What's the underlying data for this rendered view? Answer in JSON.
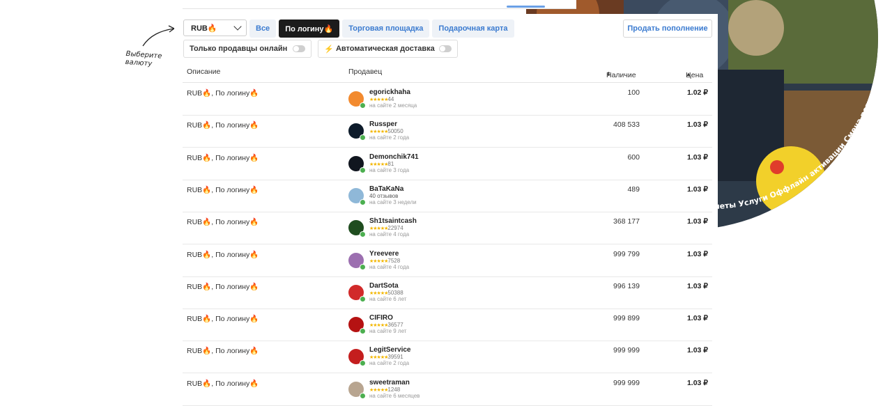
{
  "hint": {
    "text": "Выберите валюту"
  },
  "filters": {
    "currency": "RUB🔥",
    "tabs": [
      {
        "label": "Все",
        "active": false
      },
      {
        "label": "По логину🔥",
        "active": true
      },
      {
        "label": "Торговая площадка",
        "active": false
      },
      {
        "label": "Подарочная карта",
        "active": false
      }
    ],
    "sell_button": "Продать пополнение",
    "online_toggle": "Только продавцы онлайн",
    "auto_delivery_toggle": "Автоматическая доставка"
  },
  "banner": {
    "curved_text": "дметы Услуги Оффлайн активации Смена региона"
  },
  "table": {
    "headers": {
      "description": "Описание",
      "seller": "Продавец",
      "stock": "Наличие",
      "price": "Цена"
    },
    "rows": [
      {
        "desc": "RUB🔥, По логину🔥",
        "seller": "egorickhaha",
        "rating": "44",
        "since": "на сайте 2 месяца",
        "qty": "100",
        "price": "1.02 ₽",
        "avatar_color": "#f28a2e"
      },
      {
        "desc": "RUB🔥, По логину🔥",
        "seller": "Russper",
        "rating": "50050",
        "since": "на сайте 2 года",
        "qty": "408 533",
        "price": "1.03 ₽",
        "avatar_color": "#0d1b2a"
      },
      {
        "desc": "RUB🔥, По логину🔥",
        "seller": "Demonchik741",
        "rating": "81",
        "since": "на сайте 3 года",
        "qty": "600",
        "price": "1.03 ₽",
        "avatar_color": "#11161f"
      },
      {
        "desc": "RUB🔥, По логину🔥",
        "seller": "BaTaKaNa",
        "rating": "40 отзывов",
        "since": "на сайте 3 недели",
        "qty": "489",
        "price": "1.03 ₽",
        "avatar_color": "#8fb8d8"
      },
      {
        "desc": "RUB🔥, По логину🔥",
        "seller": "Sh1tsaintcash",
        "rating": "22974",
        "since": "на сайте 4 года",
        "qty": "368 177",
        "price": "1.03 ₽",
        "avatar_color": "#1f4d1f"
      },
      {
        "desc": "RUB🔥, По логину🔥",
        "seller": "Yreevere",
        "rating": "7528",
        "since": "на сайте 4 года",
        "qty": "999 799",
        "price": "1.03 ₽",
        "avatar_color": "#9c6fb0"
      },
      {
        "desc": "RUB🔥, По логину🔥",
        "seller": "DartSota",
        "rating": "50388",
        "since": "на сайте 6 лет",
        "qty": "996 139",
        "price": "1.03 ₽",
        "avatar_color": "#d12a2a"
      },
      {
        "desc": "RUB🔥, По логину🔥",
        "seller": "CIFIRO",
        "rating": "36577",
        "since": "на сайте 9 лет",
        "qty": "999 899",
        "price": "1.03 ₽",
        "avatar_color": "#b51212"
      },
      {
        "desc": "RUB🔥, По логину🔥",
        "seller": "LegitService",
        "rating": "39591",
        "since": "на сайте 2 года",
        "qty": "999 999",
        "price": "1.03 ₽",
        "avatar_color": "#c41e1e"
      },
      {
        "desc": "RUB🔥, По логину🔥",
        "seller": "sweetraman",
        "rating": "1248",
        "since": "на сайте 6 месяцев",
        "qty": "999 999",
        "price": "1.03 ₽",
        "avatar_color": "#b8a590"
      }
    ]
  }
}
